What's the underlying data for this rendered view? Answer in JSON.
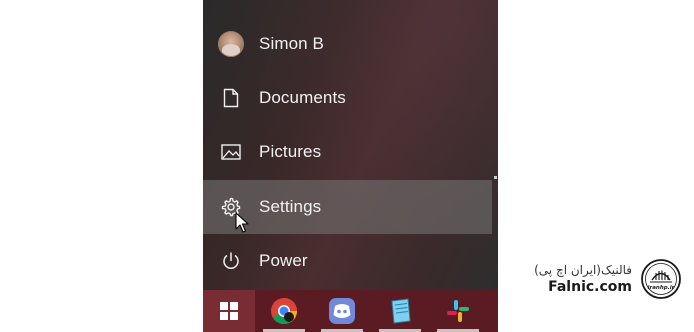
{
  "start_menu": {
    "items": [
      {
        "label": "Simon B",
        "icon": "user-avatar-icon"
      },
      {
        "label": "Documents",
        "icon": "document-icon"
      },
      {
        "label": "Pictures",
        "icon": "pictures-icon"
      },
      {
        "label": "Settings",
        "icon": "gear-icon"
      },
      {
        "label": "Power",
        "icon": "power-icon"
      }
    ],
    "hovered_item": "Settings"
  },
  "taskbar": {
    "apps": [
      {
        "name": "chrome",
        "icon": "chrome-icon"
      },
      {
        "name": "discord",
        "icon": "discord-icon"
      },
      {
        "name": "notepad",
        "icon": "notepad-icon"
      },
      {
        "name": "slack",
        "icon": "slack-icon"
      }
    ],
    "colors": {
      "background": "#5a1c22",
      "start_button": "#7a2c34"
    }
  },
  "watermark": {
    "persian_text": "فالنیک(ایران اچ پی)",
    "site": "Falnic.com",
    "logo_text": "iranhp.ir"
  }
}
